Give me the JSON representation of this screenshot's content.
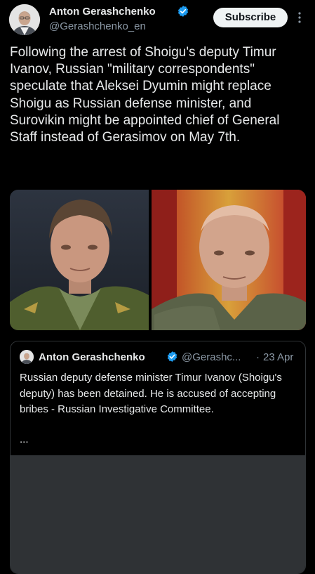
{
  "post": {
    "author_name": "Anton Gerashchenko",
    "author_handle": "@Gerashchenko_en",
    "verified": true,
    "subscribe_label": "Subscribe",
    "text": "Following the arrest of Shoigu's deputy Timur Ivanov, Russian \"military correspondents\" speculate that Aleksei Dyumin might replace Shoigu as Russian defense minister, and Surovikin might be appointed chief of General Staff instead of Gerasimov on May 7th.",
    "media_description": "two-portrait-photos"
  },
  "quote": {
    "author_name": "Anton Gerashchenko",
    "author_handle": "@Gerashc...",
    "date": "23 Apr",
    "separator": "·",
    "text": "Russian deputy defense minister Timur Ivanov (Shoigu's deputy) has been detained. He is accused of accepting bribes - Russian Investigative Committee.",
    "ellipsis": "..."
  },
  "icons": {
    "verified": "verified-badge-icon",
    "more": "more-vertical-icon"
  },
  "colors": {
    "background": "#000000",
    "text": "#e7e9ea",
    "secondary": "#8b98a5",
    "verified": "#1d9bf0",
    "border": "#2f3336"
  }
}
